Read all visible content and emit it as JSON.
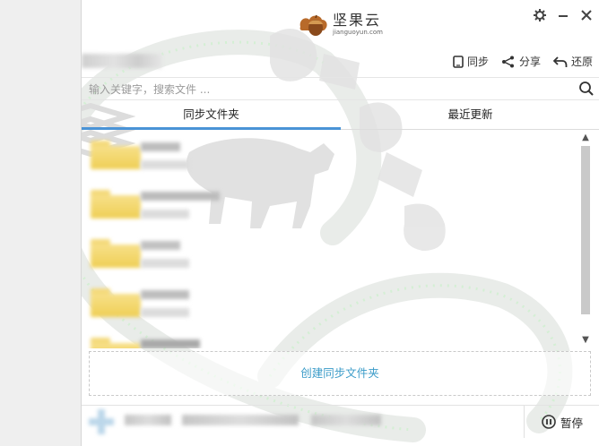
{
  "app": {
    "name": "坚果云",
    "subtitle": "jianguoyun.com"
  },
  "window_controls": {
    "settings_icon": "gear-icon",
    "minimize_icon": "minimize-icon",
    "close_icon": "close-icon"
  },
  "toolbar": {
    "sync_label": "同步",
    "share_label": "分享",
    "restore_label": "还原"
  },
  "search": {
    "placeholder": "输入关键字，搜索文件 ...",
    "value": ""
  },
  "tabs": [
    {
      "label": "同步文件夹",
      "active": true
    },
    {
      "label": "最近更新",
      "active": false
    }
  ],
  "folders": [
    {
      "name": "",
      "detail": ""
    },
    {
      "name": "",
      "detail": ""
    },
    {
      "name": "",
      "detail": ""
    },
    {
      "name": "",
      "detail": ""
    },
    {
      "name": "",
      "detail": ""
    }
  ],
  "create_folder": {
    "label": "创建同步文件夹"
  },
  "status": {
    "pause_label": "暂停"
  },
  "colors": {
    "accent": "#4a93d6",
    "link": "#3a9bc8",
    "folder": "#f0d060"
  }
}
